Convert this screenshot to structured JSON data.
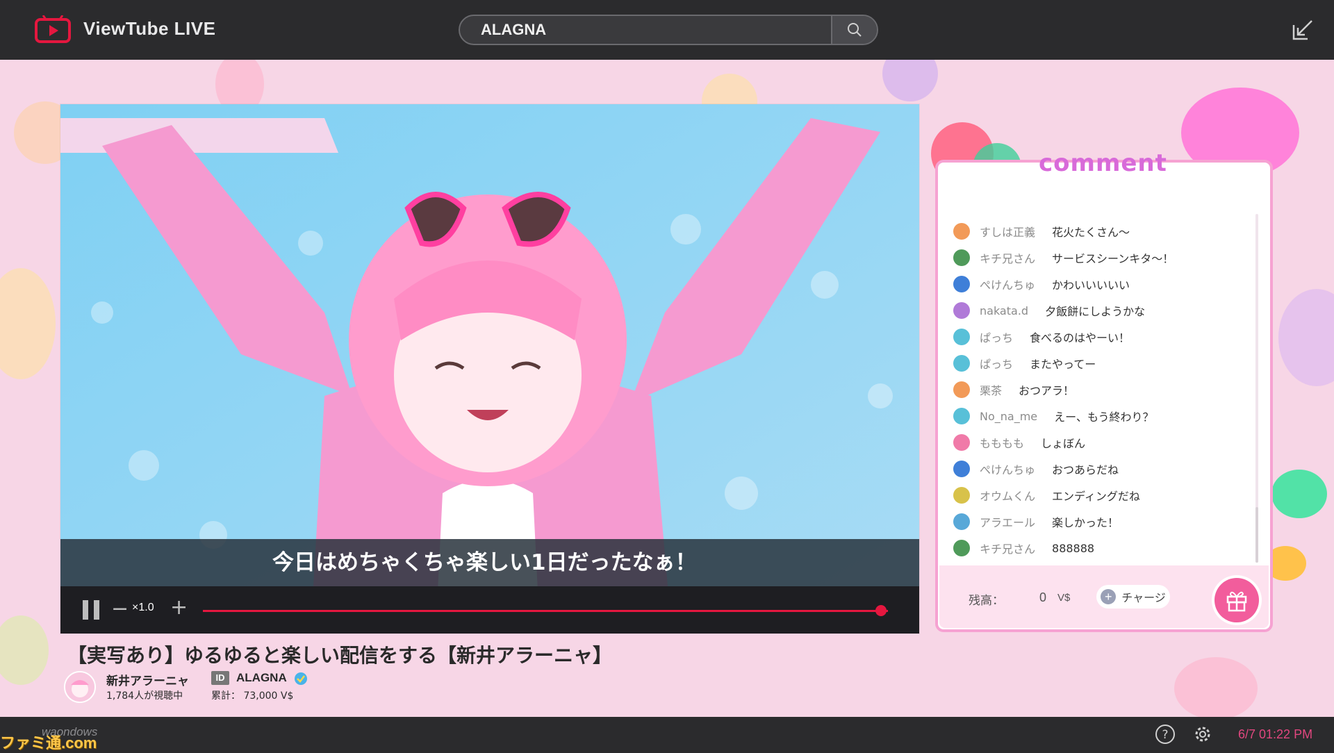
{
  "app": {
    "name": "ViewTube LIVE"
  },
  "search": {
    "value": "ALAGNA"
  },
  "player": {
    "caption": "今日はめちゃくちゃ楽しい1日だったなぁ！",
    "speed_minus": "−",
    "speed_label": "×1.0",
    "speed_plus": "+",
    "progress": 0.99
  },
  "stream": {
    "title": "【実写あり】ゆるゆると楽しい配信をする【新井アラーニャ】",
    "channel_name": "新井アラーニャ",
    "viewers": "1,784人が視聴中",
    "id_label": "ID",
    "id_value": "ALAGNA",
    "total": "累計：  73,000 V$"
  },
  "comments": {
    "title": "comment",
    "items": [
      {
        "user": "すしは正義",
        "text": "花火たくさん〜",
        "color": "#f29a58"
      },
      {
        "user": "キチ兄さん",
        "text": "サービスシーンキタ〜！",
        "color": "#4f9a5a"
      },
      {
        "user": "ぺけんちゅ",
        "text": "かわいいいいい",
        "color": "#3f7fd8"
      },
      {
        "user": "nakata.d",
        "text": "夕飯餅にしようかな",
        "color": "#b07ad8"
      },
      {
        "user": "ぱっち",
        "text": "食べるのはやーい！",
        "color": "#58c0d8"
      },
      {
        "user": "ぱっち",
        "text": "またやってー",
        "color": "#58c0d8"
      },
      {
        "user": "栗茶",
        "text": "おつアラ！",
        "color": "#f29a58"
      },
      {
        "user": "No_na_me",
        "text": "えー、もう終わり？",
        "color": "#58c0d8"
      },
      {
        "user": "もももも",
        "text": "しょぼん",
        "color": "#f07aa8"
      },
      {
        "user": "ぺけんちゅ",
        "text": "おつあらだね",
        "color": "#3f7fd8"
      },
      {
        "user": "オウムくん",
        "text": "エンディングだね",
        "color": "#d8c24a"
      },
      {
        "user": "アラエール",
        "text": "楽しかった！",
        "color": "#58a8d8"
      },
      {
        "user": "キチ兄さん",
        "text": "888888",
        "color": "#4f9a5a"
      }
    ],
    "balance_label": "残高：",
    "balance_value": "0",
    "balance_unit": "V$",
    "charge_label": "チャージ"
  },
  "taskbar": {
    "os_name": "waondows",
    "datetime": "6/7  01:22 PM",
    "watermark": "ファミ通.com"
  },
  "colors": {
    "accent": "#e5173f",
    "brand": "#e5173f",
    "panel_border": "#f6a2d2",
    "stage_bg": "#f7d6e6"
  }
}
